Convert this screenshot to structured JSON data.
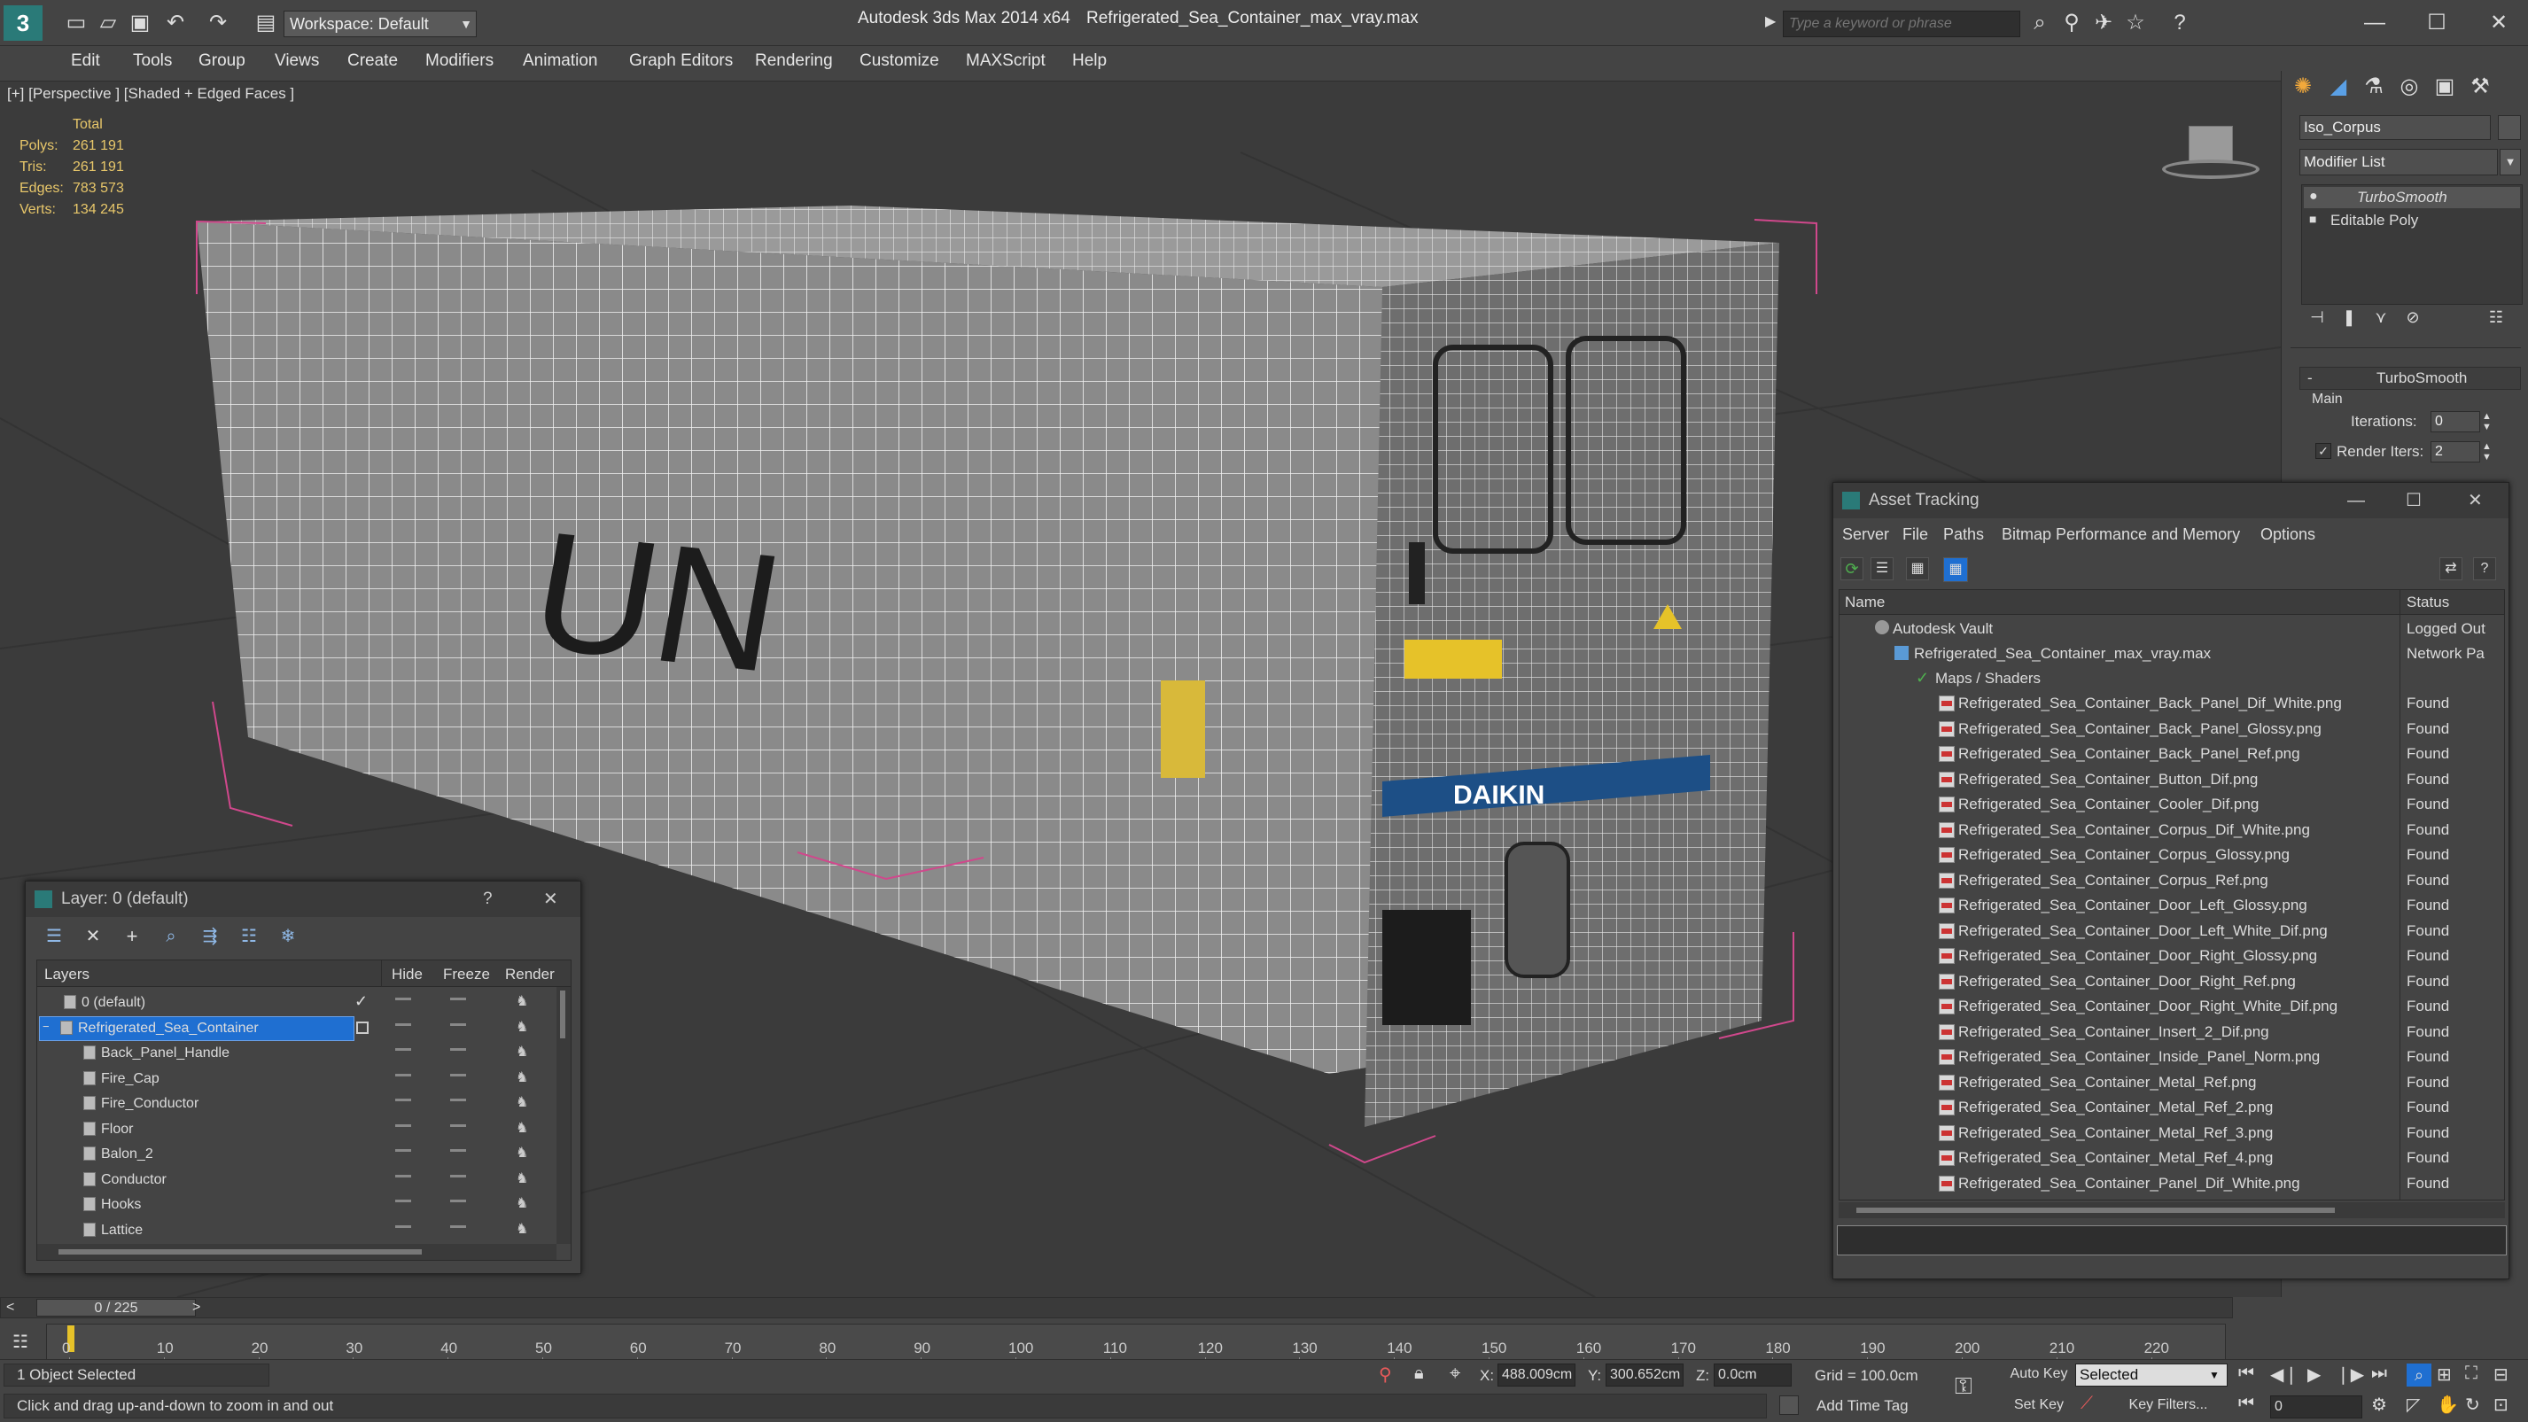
{
  "app": {
    "title": "Autodesk 3ds Max  2014 x64",
    "file": "Refrigerated_Sea_Container_max_vray.max",
    "workspace": "Workspace: Default",
    "search_placeholder": "Type a keyword or phrase"
  },
  "menu": [
    "Edit",
    "Tools",
    "Group",
    "Views",
    "Create",
    "Modifiers",
    "Animation",
    "Graph Editors",
    "Rendering",
    "Customize",
    "MAXScript",
    "Help"
  ],
  "viewport": {
    "label": "[+] [Perspective ] [Shaded + Edged Faces ]",
    "stats": {
      "header": "Total",
      "rows": [
        {
          "label": "Polys:",
          "value": "261 191"
        },
        {
          "label": "Tris:",
          "value": "261 191"
        },
        {
          "label": "Edges:",
          "value": "783 573"
        },
        {
          "label": "Verts:",
          "value": "134 245"
        }
      ]
    },
    "decal_text": "UN"
  },
  "command_panel": {
    "object_name": "Iso_Corpus",
    "modifier_list": "Modifier List",
    "stack": [
      "TurboSmooth",
      "Editable Poly"
    ],
    "rollout_title": "TurboSmooth",
    "group_main": "Main",
    "iterations_label": "Iterations:",
    "iterations_value": "0",
    "render_iters_label": "Render Iters:",
    "render_iters_value": "2"
  },
  "asset_tracking": {
    "title": "Asset Tracking",
    "menu": [
      "Server",
      "File",
      "Paths",
      "Bitmap Performance and Memory",
      "Options"
    ],
    "col_name": "Name",
    "col_status": "Status",
    "vault": {
      "name": "Autodesk Vault",
      "status": "Logged Out"
    },
    "file": {
      "name": "Refrigerated_Sea_Container_max_vray.max",
      "status": "Network Pa"
    },
    "maps_label": "Maps / Shaders",
    "files": [
      {
        "name": "Refrigerated_Sea_Container_Back_Panel_Dif_White.png",
        "status": "Found"
      },
      {
        "name": "Refrigerated_Sea_Container_Back_Panel_Glossy.png",
        "status": "Found"
      },
      {
        "name": "Refrigerated_Sea_Container_Back_Panel_Ref.png",
        "status": "Found"
      },
      {
        "name": "Refrigerated_Sea_Container_Button_Dif.png",
        "status": "Found"
      },
      {
        "name": "Refrigerated_Sea_Container_Cooler_Dif.png",
        "status": "Found"
      },
      {
        "name": "Refrigerated_Sea_Container_Corpus_Dif_White.png",
        "status": "Found"
      },
      {
        "name": "Refrigerated_Sea_Container_Corpus_Glossy.png",
        "status": "Found"
      },
      {
        "name": "Refrigerated_Sea_Container_Corpus_Ref.png",
        "status": "Found"
      },
      {
        "name": "Refrigerated_Sea_Container_Door_Left_Glossy.png",
        "status": "Found"
      },
      {
        "name": "Refrigerated_Sea_Container_Door_Left_White_Dif.png",
        "status": "Found"
      },
      {
        "name": "Refrigerated_Sea_Container_Door_Right_Glossy.png",
        "status": "Found"
      },
      {
        "name": "Refrigerated_Sea_Container_Door_Right_Ref.png",
        "status": "Found"
      },
      {
        "name": "Refrigerated_Sea_Container_Door_Right_White_Dif.png",
        "status": "Found"
      },
      {
        "name": "Refrigerated_Sea_Container_Insert_2_Dif.png",
        "status": "Found"
      },
      {
        "name": "Refrigerated_Sea_Container_Inside_Panel_Norm.png",
        "status": "Found"
      },
      {
        "name": "Refrigerated_Sea_Container_Metal_Ref.png",
        "status": "Found"
      },
      {
        "name": "Refrigerated_Sea_Container_Metal_Ref_2.png",
        "status": "Found"
      },
      {
        "name": "Refrigerated_Sea_Container_Metal_Ref_3.png",
        "status": "Found"
      },
      {
        "name": "Refrigerated_Sea_Container_Metal_Ref_4.png",
        "status": "Found"
      },
      {
        "name": "Refrigerated_Sea_Container_Panel_Dif_White.png",
        "status": "Found"
      }
    ]
  },
  "layers": {
    "title": "Layer: 0 (default)",
    "help": "?",
    "col_layers": "Layers",
    "col_hide": "Hide",
    "col_freeze": "Freeze",
    "col_render": "Render",
    "rows": [
      "0 (default)",
      "Refrigerated_Sea_Container",
      "Back_Panel_Handle",
      "Fire_Cap",
      "Fire_Conductor",
      "Floor",
      "Balon_2",
      "Conductor",
      "Hooks",
      "Lattice"
    ]
  },
  "timeline": {
    "frame_counter": "0 / 225",
    "ticks": [
      "0",
      "10",
      "20",
      "30",
      "40",
      "50",
      "60",
      "70",
      "80",
      "90",
      "100",
      "110",
      "120",
      "130",
      "140",
      "150",
      "160",
      "170",
      "180",
      "190",
      "200",
      "210",
      "220"
    ]
  },
  "status": {
    "selected": "1 Object Selected",
    "prompt": "Click and drag up-and-down to zoom in and out",
    "x_label": "X:",
    "x_value": "488.009cm",
    "y_label": "Y:",
    "y_value": "300.652cm",
    "z_label": "Z:",
    "z_value": "0.0cm",
    "grid": "Grid = 100.0cm",
    "auto_key": "Auto Key",
    "set_key": "Set Key",
    "selected_dropdown": "Selected",
    "key_filters": "Key Filters...",
    "add_time_tag": "Add Time Tag",
    "frame_value": "0"
  },
  "colors": {
    "accent": "#1f6fd1",
    "stats_value": "#e8c76a",
    "selection_line": "#d0488c"
  }
}
